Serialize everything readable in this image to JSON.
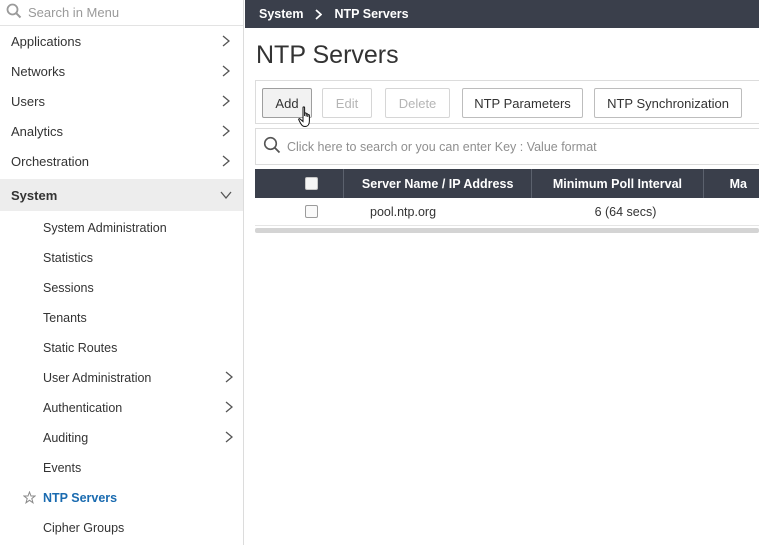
{
  "sidebar": {
    "search_placeholder": "Search in Menu",
    "items": [
      {
        "label": "Applications"
      },
      {
        "label": "Networks"
      },
      {
        "label": "Users"
      },
      {
        "label": "Analytics"
      },
      {
        "label": "Orchestration"
      },
      {
        "label": "System"
      }
    ],
    "sub_items": [
      {
        "label": "System Administration"
      },
      {
        "label": "Statistics"
      },
      {
        "label": "Sessions"
      },
      {
        "label": "Tenants"
      },
      {
        "label": "Static Routes"
      },
      {
        "label": "User Administration"
      },
      {
        "label": "Authentication"
      },
      {
        "label": "Auditing"
      },
      {
        "label": "Events"
      },
      {
        "label": "NTP Servers"
      },
      {
        "label": "Cipher Groups"
      }
    ]
  },
  "breadcrumb": {
    "root": "System",
    "current": "NTP Servers"
  },
  "page": {
    "title": "NTP Servers"
  },
  "toolbar": {
    "add_label": "Add",
    "edit_label": "Edit",
    "delete_label": "Delete",
    "ntp_parameters_label": "NTP Parameters",
    "ntp_sync_label": "NTP Synchronization"
  },
  "table_search": {
    "placeholder": "Click here to search or you can enter Key : Value format"
  },
  "table": {
    "columns": [
      "Server Name / IP Address",
      "Minimum Poll Interval",
      "Ma"
    ],
    "rows": [
      {
        "server": "pool.ntp.org",
        "min_poll": "6 (64 secs)"
      }
    ]
  },
  "colors": {
    "topbar": "#3a3f4b",
    "accent": "#1a6bb0"
  }
}
